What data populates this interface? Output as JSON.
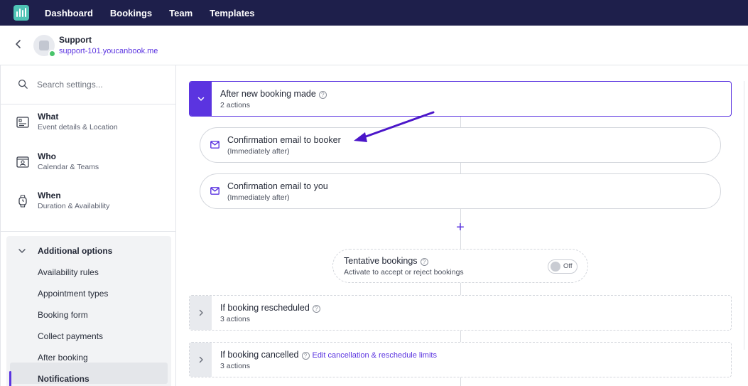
{
  "topnav": {
    "links": [
      "Dashboard",
      "Bookings",
      "Team",
      "Templates"
    ]
  },
  "account": {
    "name": "Support",
    "url": "support-101.youcanbook.me"
  },
  "sidebar": {
    "search_placeholder": "Search settings...",
    "sections": [
      {
        "title": "What",
        "subtitle": "Event details & Location",
        "icon": "details-icon"
      },
      {
        "title": "Who",
        "subtitle": "Calendar & Teams",
        "icon": "team-calendar-icon"
      },
      {
        "title": "When",
        "subtitle": "Duration & Availability",
        "icon": "watch-icon"
      }
    ],
    "additional": {
      "title": "Additional options",
      "items": [
        "Availability rules",
        "Appointment types",
        "Booking form",
        "Collect payments",
        "After booking",
        "Notifications"
      ],
      "active": "Notifications"
    }
  },
  "main": {
    "trigger_new": {
      "title": "After new booking made",
      "subtitle": "2 actions",
      "expanded": true
    },
    "actions": [
      {
        "title": "Confirmation email to booker",
        "subtitle": "(Immediately after)",
        "icon": "mail-icon"
      },
      {
        "title": "Confirmation email to you",
        "subtitle": "(Immediately after)",
        "icon": "mail-icon"
      }
    ],
    "add_symbol": "+",
    "tentative": {
      "title": "Tentative bookings",
      "subtitle": "Activate to accept or reject bookings",
      "toggle_label": "Off"
    },
    "trigger_rescheduled": {
      "title": "If booking rescheduled",
      "subtitle": "3 actions"
    },
    "trigger_cancelled": {
      "title": "If booking cancelled",
      "subtitle": "3 actions",
      "link": "Edit cancellation & reschedule limits"
    },
    "help_symbol": "?"
  },
  "colors": {
    "nav_bg": "#1e1f4b",
    "accent": "#5b34e0",
    "logo": "#4fc3b5",
    "online": "#49c46b"
  }
}
